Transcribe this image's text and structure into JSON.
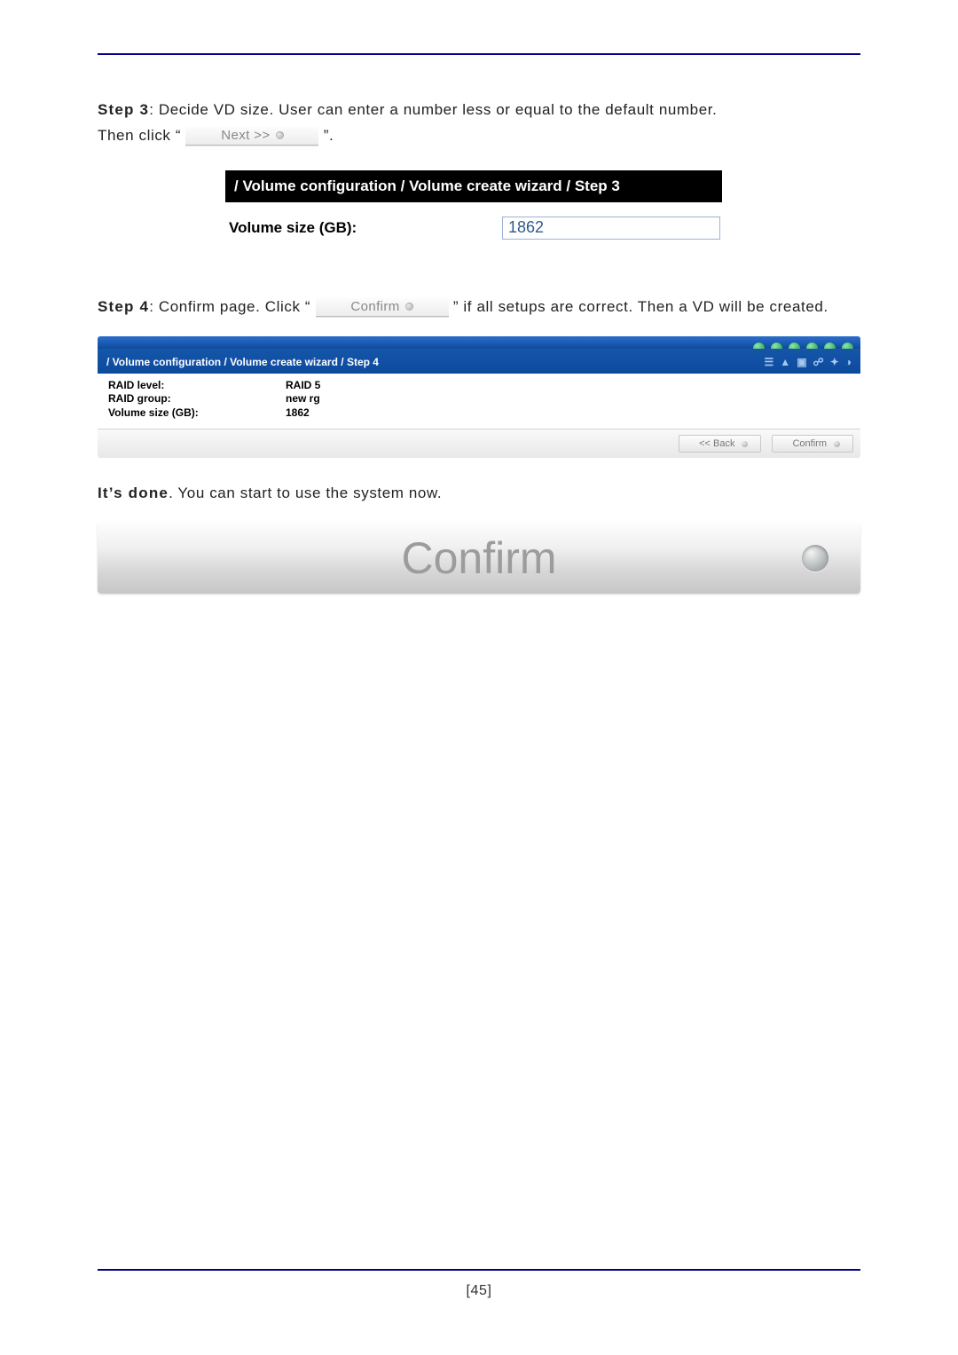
{
  "step3": {
    "label": "Step 3",
    "desc_a": ": Decide VD size. User can enter a number less or equal to the default number.",
    "then_click_a": "Then click “",
    "then_click_b": "”.",
    "next_btn": "Next >>",
    "panel": {
      "breadcrumb": "/ Volume configuration / Volume create wizard / Step 3",
      "size_label": "Volume size (GB):",
      "size_value": "1862"
    }
  },
  "step4": {
    "label": "Step 4",
    "desc_a": ": Confirm page. Click “",
    "desc_b": "” if all setups are correct. Then a VD will be created.",
    "confirm_btn": "Confirm",
    "panel": {
      "breadcrumb": "/ Volume configuration / Volume create wizard / Step 4",
      "fields": {
        "raid_level_label": "RAID level:",
        "raid_level_value": "RAID 5",
        "raid_group_label": "RAID group:",
        "raid_group_value": "new rg",
        "volume_size_label": "Volume size (GB):",
        "volume_size_value": "1862"
      },
      "back_btn": "<< Back",
      "confirm_btn": "Confirm"
    }
  },
  "done_line": "It’s done. You can start to use the system now.",
  "big_confirm_label": "Confirm",
  "page_number": "[45]"
}
